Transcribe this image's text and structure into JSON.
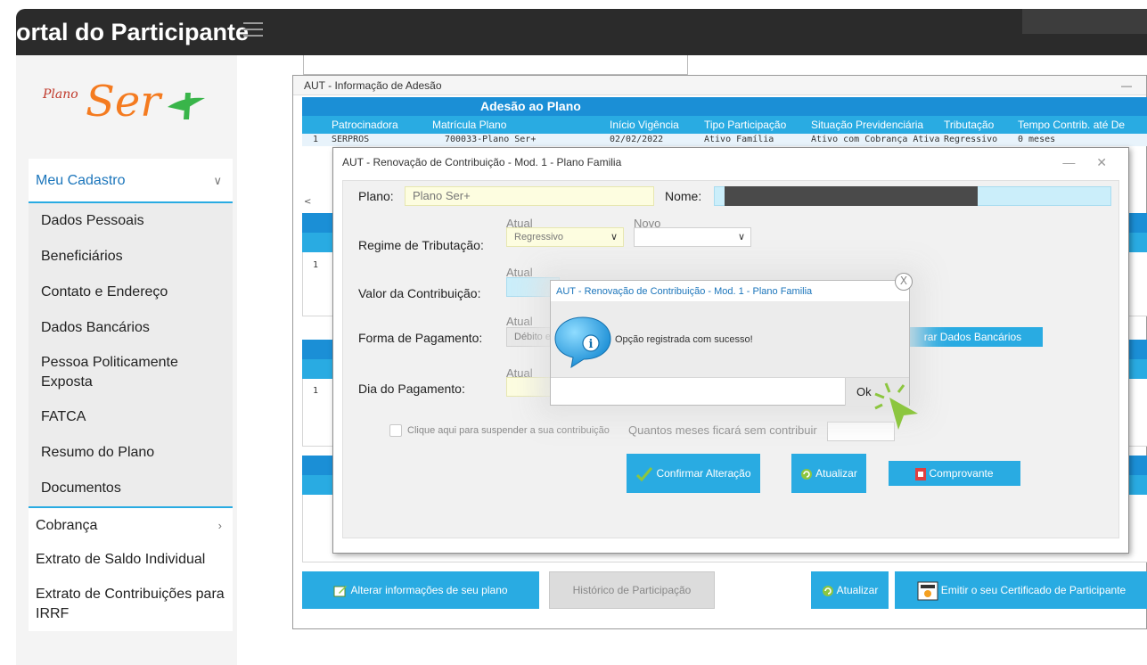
{
  "app": {
    "title": "ortal do Participante"
  },
  "logo": {
    "prefix": "Plano",
    "brand": "Ser"
  },
  "sidebar": {
    "section_label": "Meu Cadastro",
    "items": [
      {
        "label": "Dados Pessoais"
      },
      {
        "label": "Beneficiários"
      },
      {
        "label": "Contato e Endereço"
      },
      {
        "label": "Dados Bancários"
      },
      {
        "label": "Pessoa Politicamente Exposta"
      },
      {
        "label": "FATCA"
      },
      {
        "label": "Resumo do Plano"
      },
      {
        "label": "Documentos"
      }
    ],
    "cobranca": "Cobrança",
    "extrato_saldo": "Extrato de Saldo Individual",
    "extrato_contrib": "Extrato de Contribuições para IRRF"
  },
  "main_window": {
    "title": "AUT - Informação de Adesão",
    "minimize": "—",
    "adesao_header": "Adesão ao Plano",
    "columns": [
      "Patrocinadora",
      "Matrícula Plano",
      "Início Vigência",
      "Tipo Participação",
      "Situação Previdenciária",
      "Tributação",
      "Tempo Contrib. até De"
    ],
    "row": [
      "1",
      "SERPROS",
      "700033-Plano Ser+",
      "02/02/2022",
      "Ativo Família",
      "Ativo com Cobrança Ativa",
      "Regressivo",
      "0 meses"
    ],
    "row_num": "1",
    "scroll_left": "<",
    "btn_alterar": "Alterar informações de seu plano",
    "btn_historico": "Histórico de Participação",
    "btn_atualizar": "Atualizar",
    "btn_certificado": "Emitir o seu Certificado de Participante"
  },
  "dialog": {
    "title": "AUT - Renovação de Contribuição - Mod. 1 - Plano Familia",
    "controls": "— ✕",
    "plano_label": "Plano:",
    "plano_value": "Plano Ser+",
    "nome_label": "Nome:",
    "atual": "Atual",
    "novo": "Novo",
    "regime_label": "Regime de Tributação:",
    "regime_atual": "Regressivo",
    "valor_label": "Valor da Contribuição:",
    "forma_label": "Forma de Pagamento:",
    "forma_atual": "Débito e",
    "dia_label": "Dia do Pagamento:",
    "alterar_dados_bancarios": "rar Dados Bancários",
    "suspender_label": "Clique aqui para suspender a sua contribuição",
    "meses_label": "Quantos meses ficará sem contribuir",
    "btn_confirmar": "Confirmar Alteração",
    "btn_atualizar": "Atualizar",
    "btn_comprovante": "Comprovante"
  },
  "alert": {
    "title": "AUT - Renovação de Contribuição - Mod. 1 - Plano Familia",
    "message": "Opção registrada com sucesso!",
    "ok": "Ok",
    "close": "X",
    "info_icon_letter": "i"
  },
  "colors": {
    "topbar": "#2b2b2b",
    "accent": "#29abe2",
    "header_blue": "#1b8fd6",
    "sidebar_bg": "#f4f4f4",
    "logo_orange": "#f47b20",
    "logo_green": "#39b54a",
    "cursor_green": "#8cc63f"
  }
}
